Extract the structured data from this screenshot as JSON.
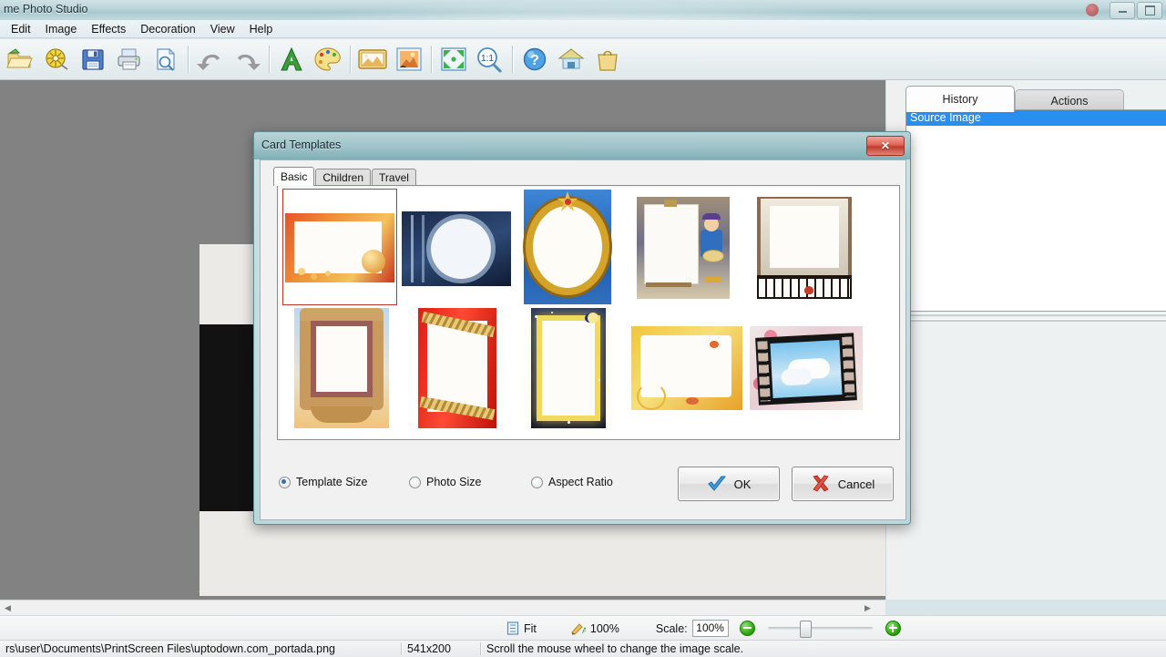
{
  "window": {
    "title": "me Photo Studio",
    "minimize_label": "Minimize",
    "maximize_label": "Maximize"
  },
  "menubar": {
    "items": [
      {
        "label": "Edit"
      },
      {
        "label": "Image"
      },
      {
        "label": "Effects"
      },
      {
        "label": "Decoration"
      },
      {
        "label": "View"
      },
      {
        "label": "Help"
      }
    ]
  },
  "toolbar": {
    "items": [
      {
        "icon": "open-folder-icon",
        "tooltip": "Open"
      },
      {
        "icon": "film-reel-icon",
        "tooltip": "Batch"
      },
      {
        "icon": "save-floppy-icon",
        "tooltip": "Save"
      },
      {
        "icon": "printer-icon",
        "tooltip": "Print"
      },
      {
        "icon": "print-preview-icon",
        "tooltip": "Print Preview"
      },
      {
        "icon": "undo-arrow-icon",
        "tooltip": "Undo"
      },
      {
        "icon": "redo-arrow-icon",
        "tooltip": "Redo"
      },
      {
        "icon": "text-a-icon",
        "tooltip": "Add Text"
      },
      {
        "icon": "palette-icon",
        "tooltip": "Paint"
      },
      {
        "icon": "picture-icon",
        "tooltip": "Image"
      },
      {
        "icon": "photo-frame-icon",
        "tooltip": "Templates"
      },
      {
        "icon": "fit-screen-icon",
        "tooltip": "Fit to Screen"
      },
      {
        "icon": "zoom-one-to-one-icon",
        "tooltip": "Actual Size"
      },
      {
        "icon": "help-question-icon",
        "tooltip": "Help"
      },
      {
        "icon": "home-icon",
        "tooltip": "Home Page"
      },
      {
        "icon": "shopping-bag-icon",
        "tooltip": "Buy"
      }
    ]
  },
  "right_panel": {
    "tabs": [
      {
        "label": "History",
        "active": true
      },
      {
        "label": "Actions",
        "active": false
      }
    ],
    "history_items": [
      {
        "label": "Source Image",
        "selected": true
      }
    ]
  },
  "zoom_bar": {
    "fit_label": "Fit",
    "actual_label": "100%",
    "scale_label": "Scale:",
    "scale_value": "100%",
    "zoom_out_icon": "zoom-out-circle-icon",
    "zoom_in_icon": "zoom-in-circle-icon",
    "slider_value": 30
  },
  "status_bar": {
    "file_path": "rs\\user\\Documents\\PrintScreen Files\\uptodown.com_portada.png",
    "dimensions": "541x200",
    "hint": "Scroll the mouse wheel to change the image scale."
  },
  "dialog": {
    "title": "Card Templates",
    "close_label": "✕",
    "tabs": [
      {
        "label": "Basic",
        "active": true
      },
      {
        "label": "Children",
        "active": false
      },
      {
        "label": "Travel",
        "active": false
      }
    ],
    "templates": [
      {
        "name": "gold-beads-landscape-frame",
        "selected": true
      },
      {
        "name": "blue-night-circle-frame",
        "selected": false
      },
      {
        "name": "gold-ornate-oval-frame",
        "selected": false
      },
      {
        "name": "cartoon-painter-easel-frame",
        "selected": false
      },
      {
        "name": "paper-on-piano-keys-frame",
        "selected": false
      },
      {
        "name": "carved-wood-baroque-frame",
        "selected": false
      },
      {
        "name": "red-ribbon-chain-frame",
        "selected": false
      },
      {
        "name": "starry-night-glow-frame",
        "selected": false
      },
      {
        "name": "yellow-watercolor-frame",
        "selected": false
      },
      {
        "name": "film-strip-clouds-frame",
        "selected": false
      }
    ],
    "size_options": [
      {
        "label": "Template Size",
        "selected": true
      },
      {
        "label": "Photo Size",
        "selected": false
      },
      {
        "label": "Aspect Ratio",
        "selected": false
      }
    ],
    "ok_label": "OK",
    "cancel_label": "Cancel"
  },
  "colors": {
    "accent": "#2a8ef0",
    "title_bar": "#a9c9cf",
    "dialog_border": "#5d8c93",
    "selection_red": "#c0392b",
    "canvas_bg": "#828282"
  }
}
